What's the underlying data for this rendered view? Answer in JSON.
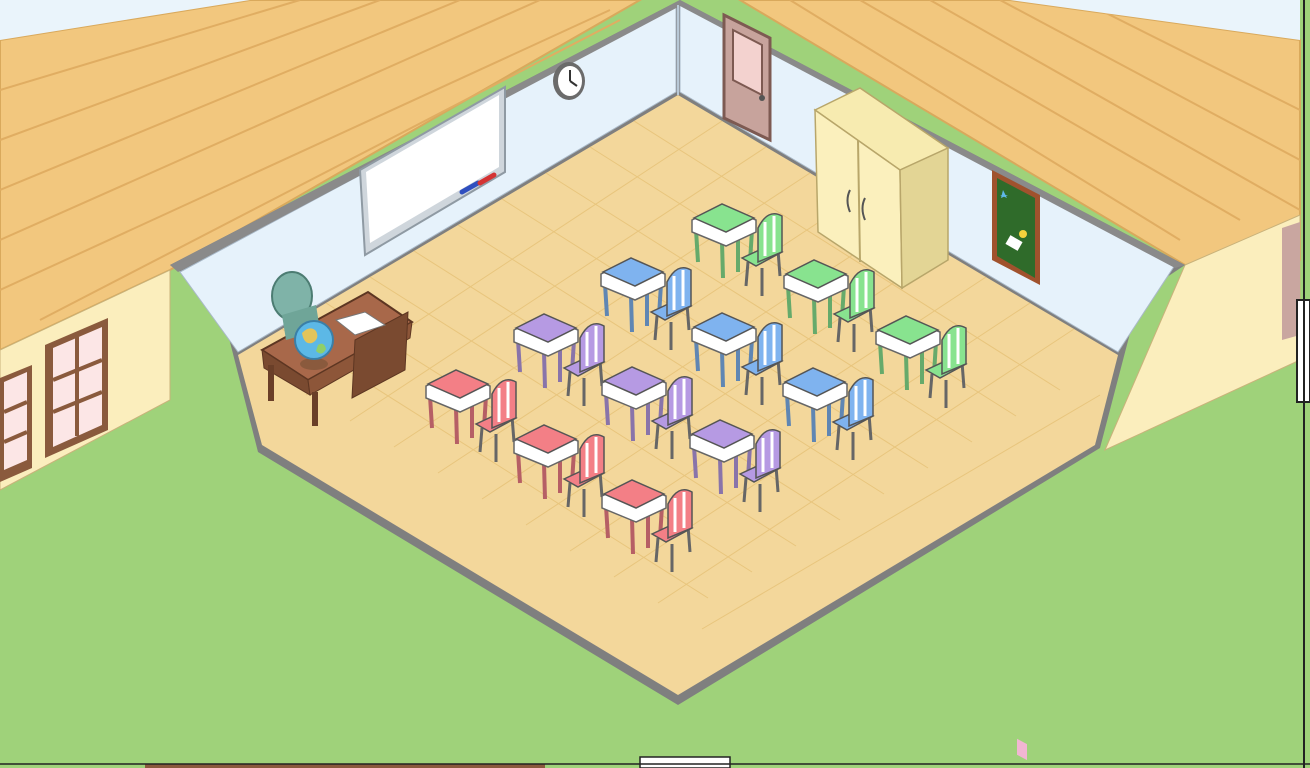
{
  "room": {
    "name": "classroom",
    "colors": {
      "grass": "#9fd27a",
      "floor": "#f3d79b",
      "wall": "#e6f2fb",
      "roof": "#f2c77e",
      "outer_wall": "#fbeebd",
      "desk_wood": "#8a5a3d",
      "board_frame": "#2f6b2a"
    }
  },
  "furniture": {
    "whiteboard": {
      "icon": "whiteboard-icon"
    },
    "clock": {
      "icon": "wall-clock-icon"
    },
    "door": {
      "icon": "door-icon"
    },
    "cabinet": {
      "icon": "cabinet-icon"
    },
    "bulletin_board": {
      "icon": "bulletin-board-icon"
    },
    "teacher_desk": {
      "icon": "teacher-desk-icon"
    },
    "teacher_chair": {
      "icon": "office-chair-icon"
    },
    "globe": {
      "icon": "globe-icon"
    }
  },
  "student_seats": [
    {
      "row": "front",
      "color_name": "red",
      "color": "#f37f86",
      "count": 3
    },
    {
      "row": "second",
      "color_name": "purple",
      "color": "#b69ae3",
      "count": 3
    },
    {
      "row": "third",
      "color_name": "blue",
      "color": "#7fb3ef",
      "count": 3
    },
    {
      "row": "back",
      "color_name": "green",
      "color": "#88e38f",
      "count": 3
    }
  ]
}
